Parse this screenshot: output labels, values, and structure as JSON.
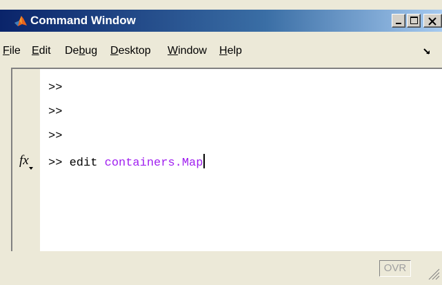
{
  "window": {
    "title": "Command Window",
    "title_icon": "matlab-logo-icon",
    "controls": [
      "minimize-icon",
      "maximize-icon",
      "close-icon"
    ]
  },
  "menu": {
    "items": [
      {
        "label": "File"
      },
      {
        "label": "Edit"
      },
      {
        "label": "Debug"
      },
      {
        "label": "Desktop"
      },
      {
        "label": "Window"
      },
      {
        "label": "Help"
      }
    ],
    "undock_icon": "undock-arrow-icon"
  },
  "command": {
    "lines": [
      {
        "prompt": ">>"
      },
      {
        "prompt": ">>"
      },
      {
        "prompt": ">>"
      }
    ],
    "current": {
      "prompt": ">>",
      "command": "edit",
      "argument": "containers.Map"
    },
    "fx_label": "fx",
    "argument_color": "#a020f0"
  },
  "status": {
    "ovr_label": "OVR"
  },
  "colors": {
    "titlebar_start": "#0a246a",
    "titlebar_end": "#a6caf0",
    "window_bg": "#ece9d8"
  }
}
